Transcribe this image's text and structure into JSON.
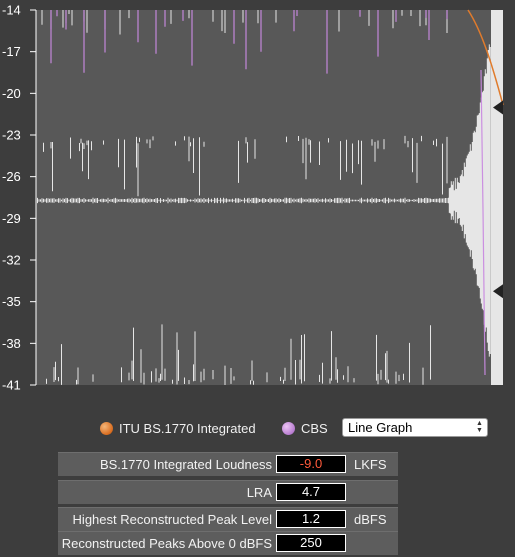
{
  "graph": {
    "y_axis_ticks": [
      "-14",
      "-17",
      "-20",
      "-23",
      "-26",
      "-29",
      "-32",
      "-35",
      "-38",
      "-41"
    ],
    "colors": {
      "background": "#585858",
      "waveform": "#e6e6e6",
      "itu_line": "#e07b2c",
      "cbs_line": "#c98ae0",
      "axis": "#ffffff",
      "marker": "#222222"
    }
  },
  "legend": {
    "itu_label": "ITU BS.1770 Integrated",
    "cbs_label": "CBS"
  },
  "display_mode": {
    "selected": "Line Graph"
  },
  "metrics": [
    {
      "label": "BS.1770 Integrated Loudness",
      "value": "-9.0",
      "unit": "LKFS"
    },
    {
      "label": "LRA",
      "value": "4.7",
      "unit": ""
    },
    {
      "label": "Highest Reconstructed Peak Level",
      "value": "1.2",
      "unit": "dBFS"
    },
    {
      "label": "Reconstructed Peaks Above 0 dBFS",
      "value": "250",
      "unit": ""
    }
  ]
}
